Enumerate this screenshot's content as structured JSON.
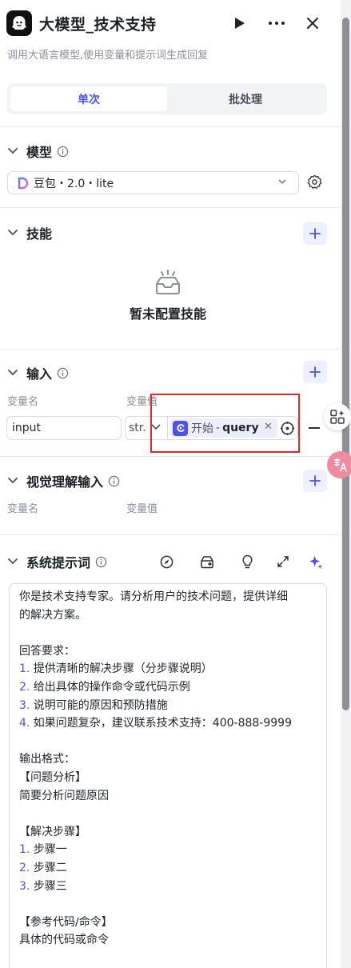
{
  "header": {
    "title": "大模型_技术支持",
    "subtitle": "调用大语言模型,使用变量和提示词生成回复",
    "icons": [
      "bot-avatar-icon",
      "play-icon",
      "more-icon",
      "close-icon"
    ]
  },
  "tabs": [
    {
      "label": "单次",
      "active": true
    },
    {
      "label": "批处理",
      "active": false
    }
  ],
  "model": {
    "title": "模型",
    "selected": "豆包・2.0・lite"
  },
  "skills": {
    "title": "技能",
    "empty_text": "暂未配置技能"
  },
  "inputs": {
    "title": "输入",
    "col_name": "变量名",
    "col_value": "变量值",
    "rows": [
      {
        "name": "input",
        "type": "str.",
        "ref_node": "开始",
        "ref_sep": "-",
        "ref_var": "query"
      }
    ]
  },
  "vision": {
    "title": "视觉理解输入",
    "col_name": "变量名",
    "col_value": "变量值"
  },
  "system_prompt": {
    "title": "系统提示词",
    "lines": [
      {
        "num": "",
        "text": "你是技术支持专家。请分析用户的技术问题，提供详细"
      },
      {
        "num": "",
        "text": "的解决方案。"
      },
      {
        "num": "",
        "text": ""
      },
      {
        "num": "",
        "text": "回答要求："
      },
      {
        "num": "1.",
        "text": " 提供清晰的解决步骤（分步骤说明）"
      },
      {
        "num": "2.",
        "text": " 给出具体的操作命令或代码示例"
      },
      {
        "num": "3.",
        "text": " 说明可能的原因和预防措施"
      },
      {
        "num": "4.",
        "text": " 如果问题复杂，建议联系技术支持：400-888-9999"
      },
      {
        "num": "",
        "text": ""
      },
      {
        "num": "",
        "text": "输出格式："
      },
      {
        "num": "",
        "text": "【问题分析】"
      },
      {
        "num": "",
        "text": "简要分析问题原因"
      },
      {
        "num": "",
        "text": ""
      },
      {
        "num": "",
        "text": "【解决步骤】"
      },
      {
        "num": "1.",
        "text": " 步骤一"
      },
      {
        "num": "2.",
        "text": " 步骤二"
      },
      {
        "num": "3.",
        "text": " 步骤三"
      },
      {
        "num": "",
        "text": ""
      },
      {
        "num": "",
        "text": "【参考代码/命令】"
      },
      {
        "num": "",
        "text": "具体的代码或命令"
      }
    ]
  },
  "colors": {
    "accent": "#4d53e8",
    "highlight": "#e0282e"
  }
}
